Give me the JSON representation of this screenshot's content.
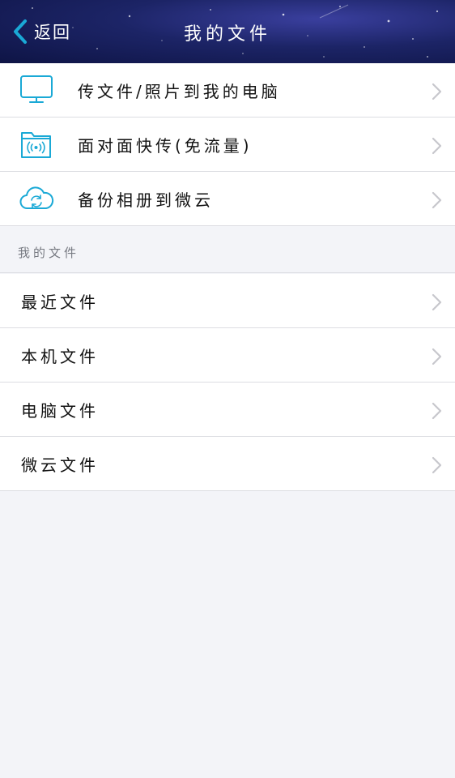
{
  "nav": {
    "back_label": "返回",
    "title": "我的文件"
  },
  "transfer_items": [
    {
      "icon": "computer-icon",
      "label": "传文件/照片到我的电脑"
    },
    {
      "icon": "face-to-face-transfer-icon",
      "label": "面对面快传(免流量)"
    },
    {
      "icon": "cloud-sync-icon",
      "label": "备份相册到微云"
    }
  ],
  "section": {
    "title": "我的文件"
  },
  "file_items": [
    {
      "label": "最近文件"
    },
    {
      "label": "本机文件"
    },
    {
      "label": "电脑文件"
    },
    {
      "label": "微云文件"
    }
  ],
  "colors": {
    "accent": "#1aa9d6",
    "navbar": "#1c2466",
    "background": "#f3f4f8",
    "chevron": "#c7c7cc"
  }
}
